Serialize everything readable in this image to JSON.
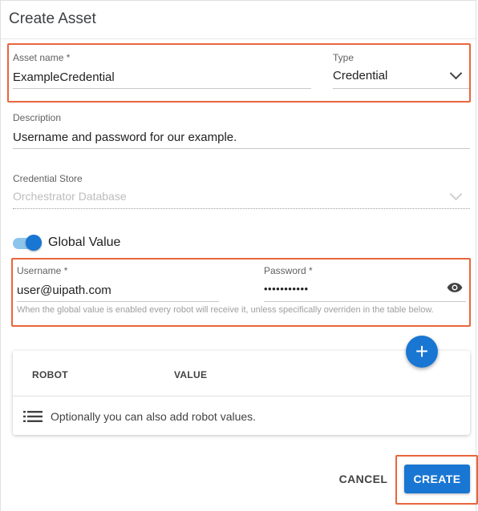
{
  "dialog": {
    "title": "Create Asset"
  },
  "form": {
    "asset_name": {
      "label": "Asset name *",
      "value": "ExampleCredential"
    },
    "type": {
      "label": "Type",
      "value": "Credential"
    },
    "description": {
      "label": "Description",
      "value": "Username and password for our example."
    },
    "credential_store": {
      "label": "Credential Store",
      "value": "Orchestrator Database"
    },
    "global_value": {
      "label": "Global Value",
      "enabled": true
    },
    "username": {
      "label": "Username *",
      "value": "user@uipath.com"
    },
    "password": {
      "label": "Password *",
      "value": "•••••••••••"
    },
    "hint": "When the global value is enabled every robot will receive it, unless specifically overriden in the table below."
  },
  "robot_table": {
    "columns": [
      "ROBOT",
      "VALUE"
    ],
    "empty_text": "Optionally you can also add robot values.",
    "add_button_label": "+"
  },
  "actions": {
    "cancel_label": "CANCEL",
    "create_label": "CREATE"
  },
  "colors": {
    "primary": "#1976d2",
    "highlight": "#e8663d"
  },
  "icons": {
    "type_dropdown": "chevron-down-icon",
    "store_dropdown": "chevron-down-icon",
    "password_visibility": "eye-icon",
    "empty_list": "list-icon",
    "add": "plus-icon"
  }
}
